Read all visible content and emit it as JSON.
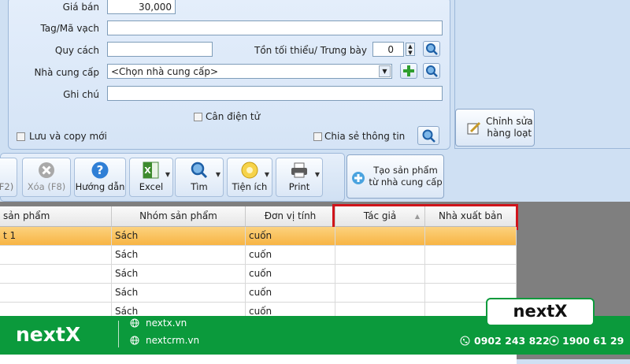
{
  "form": {
    "price_label": "Giá bán",
    "price_value": "30,000",
    "tag_label": "Tag/Mã vạch",
    "spec_label": "Quy cách",
    "min_stock_label": "Tồn tối thiểu/ Trưng bày",
    "min_stock_value": "0",
    "supplier_label": "Nhà cung cấp",
    "supplier_value": "<Chọn nhà cung cấp>",
    "note_label": "Ghi chú",
    "scale_label": "Cân điện tử",
    "save_copy_label": "Lưu và copy mới",
    "share_label": "Chia sẻ thông tin"
  },
  "right_panel": {
    "bulk_edit_label": "Chỉnh sửa\nhàng loạt"
  },
  "toolbar": {
    "partial_label": "F2)",
    "delete_label": "Xóa (F8)",
    "guide_label": "Hướng dẫn",
    "excel_label": "Excel",
    "search_label": "Tìm",
    "utility_label": "Tiện ích",
    "print_label": "Print",
    "create_from_supplier_label": "Tạo sản phẩm\ntừ nhà cung cấp"
  },
  "grid": {
    "headers": [
      "sản phẩm",
      "Nhóm sản phẩm",
      "Đơn vị tính",
      "Tác giả",
      "Nhà xuất bản"
    ],
    "rows": [
      [
        "t 1",
        "Sách",
        "cuốn",
        "",
        ""
      ],
      [
        "",
        "Sách",
        "cuốn",
        "",
        ""
      ],
      [
        "",
        "Sách",
        "cuốn",
        "",
        ""
      ],
      [
        "",
        "Sách",
        "cuốn",
        "",
        ""
      ],
      [
        "",
        "Sách",
        "cuốn",
        "",
        ""
      ]
    ]
  },
  "brand": {
    "logo": "nextX",
    "website_1": "nextx.vn",
    "website_2": "nextcrm.vn",
    "phone_1": "0902 243 822",
    "phone_2": "1900 61 29",
    "badge": "nextX"
  },
  "colors": {
    "highlight_border": "#d0141b",
    "selected_row": "#fbc15c",
    "brand_green": "#0b9a3c"
  }
}
